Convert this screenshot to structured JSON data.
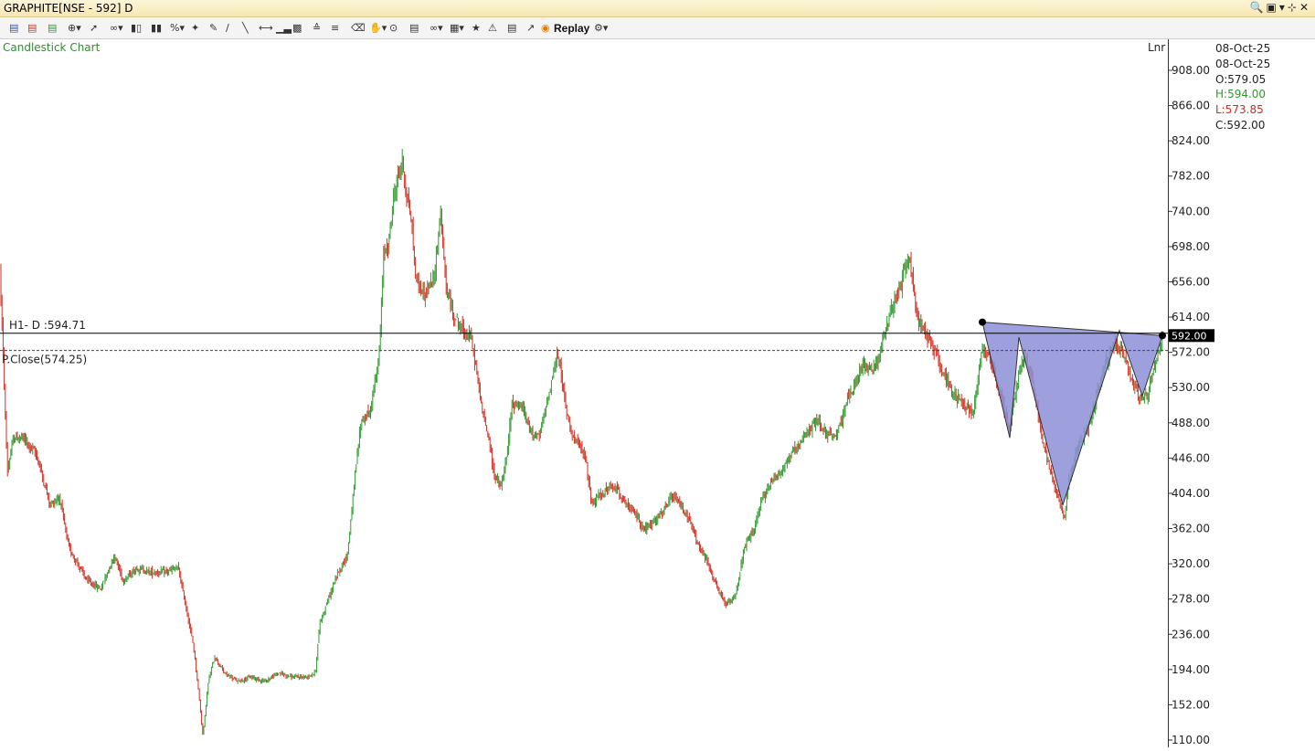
{
  "window": {
    "title": "GRAPHITE[NSE - 592] D"
  },
  "chart": {
    "type_label": "Candlestick Chart",
    "scale_mode": "Lnr",
    "hline_label": "H1- D :594.71",
    "hline_value": 594.71,
    "prev_close_label": "P.Close(574.25)",
    "prev_close_value": 574.25,
    "last_price_label": "592.00",
    "last_price": 592.0,
    "y_ticks": [
      "908.00",
      "866.00",
      "824.00",
      "782.00",
      "740.00",
      "698.00",
      "656.00",
      "614.00",
      "572.00",
      "530.00",
      "488.00",
      "446.00",
      "404.00",
      "362.00",
      "320.00",
      "278.00",
      "236.00",
      "194.00",
      "152.00",
      "110.00"
    ],
    "colors": {
      "up": "#2e9a2e",
      "down": "#d62a1e",
      "pattern_fill": "#8c8fd6",
      "title_green": "#2f8f2f"
    }
  },
  "toolbar": {
    "replay_label": "Replay"
  },
  "ohlc": {
    "date1": "08-Oct-25",
    "date2": "08-Oct-25",
    "open": "O:579.05",
    "high": "H:594.00",
    "low": "L:573.85",
    "close": "C:592.00"
  },
  "chart_data": {
    "type": "line",
    "title": "Candlestick Chart",
    "ylim": [
      110,
      908
    ],
    "y_ticks": [
      908,
      866,
      824,
      782,
      740,
      698,
      656,
      614,
      572,
      530,
      488,
      446,
      404,
      362,
      320,
      278,
      236,
      194,
      152,
      110
    ],
    "price_path": [
      [
        0,
        670
      ],
      [
        8,
        430
      ],
      [
        15,
        470
      ],
      [
        25,
        470
      ],
      [
        40,
        450
      ],
      [
        55,
        390
      ],
      [
        65,
        400
      ],
      [
        75,
        340
      ],
      [
        85,
        320
      ],
      [
        95,
        300
      ],
      [
        110,
        290
      ],
      [
        125,
        330
      ],
      [
        135,
        300
      ],
      [
        150,
        315
      ],
      [
        165,
        310
      ],
      [
        180,
        310
      ],
      [
        195,
        315
      ],
      [
        205,
        260
      ],
      [
        212,
        220
      ],
      [
        218,
        160
      ],
      [
        222,
        115
      ],
      [
        228,
        180
      ],
      [
        235,
        210
      ],
      [
        245,
        190
      ],
      [
        260,
        180
      ],
      [
        275,
        185
      ],
      [
        290,
        180
      ],
      [
        305,
        190
      ],
      [
        320,
        185
      ],
      [
        335,
        185
      ],
      [
        345,
        190
      ],
      [
        350,
        250
      ],
      [
        360,
        280
      ],
      [
        370,
        310
      ],
      [
        380,
        330
      ],
      [
        390,
        440
      ],
      [
        395,
        490
      ],
      [
        405,
        500
      ],
      [
        415,
        570
      ],
      [
        420,
        690
      ],
      [
        425,
        700
      ],
      [
        430,
        750
      ],
      [
        435,
        780
      ],
      [
        440,
        800
      ],
      [
        445,
        760
      ],
      [
        450,
        730
      ],
      [
        455,
        660
      ],
      [
        465,
        640
      ],
      [
        475,
        660
      ],
      [
        482,
        740
      ],
      [
        488,
        650
      ],
      [
        495,
        620
      ],
      [
        505,
        600
      ],
      [
        515,
        590
      ],
      [
        520,
        560
      ],
      [
        528,
        500
      ],
      [
        535,
        470
      ],
      [
        540,
        430
      ],
      [
        548,
        410
      ],
      [
        555,
        450
      ],
      [
        560,
        510
      ],
      [
        570,
        510
      ],
      [
        580,
        480
      ],
      [
        590,
        470
      ],
      [
        600,
        520
      ],
      [
        610,
        570
      ],
      [
        615,
        540
      ],
      [
        620,
        500
      ],
      [
        628,
        470
      ],
      [
        640,
        450
      ],
      [
        648,
        390
      ],
      [
        655,
        400
      ],
      [
        665,
        410
      ],
      [
        675,
        410
      ],
      [
        685,
        390
      ],
      [
        695,
        380
      ],
      [
        705,
        360
      ],
      [
        715,
        370
      ],
      [
        725,
        380
      ],
      [
        735,
        400
      ],
      [
        745,
        390
      ],
      [
        755,
        370
      ],
      [
        765,
        340
      ],
      [
        775,
        320
      ],
      [
        785,
        290
      ],
      [
        795,
        270
      ],
      [
        805,
        285
      ],
      [
        815,
        340
      ],
      [
        825,
        360
      ],
      [
        835,
        400
      ],
      [
        845,
        420
      ],
      [
        855,
        430
      ],
      [
        865,
        450
      ],
      [
        875,
        460
      ],
      [
        885,
        480
      ],
      [
        895,
        490
      ],
      [
        905,
        475
      ],
      [
        915,
        470
      ],
      [
        925,
        510
      ],
      [
        935,
        530
      ],
      [
        945,
        560
      ],
      [
        955,
        550
      ],
      [
        965,
        580
      ],
      [
        975,
        620
      ],
      [
        985,
        650
      ],
      [
        995,
        690
      ],
      [
        1000,
        640
      ],
      [
        1005,
        610
      ],
      [
        1015,
        590
      ],
      [
        1025,
        570
      ],
      [
        1035,
        540
      ],
      [
        1045,
        520
      ],
      [
        1055,
        510
      ],
      [
        1065,
        500
      ],
      [
        1075,
        580
      ],
      [
        1085,
        560
      ],
      [
        1095,
        520
      ],
      [
        1105,
        480
      ],
      [
        1110,
        520
      ],
      [
        1120,
        570
      ],
      [
        1130,
        540
      ],
      [
        1140,
        470
      ],
      [
        1150,
        430
      ],
      [
        1160,
        390
      ],
      [
        1165,
        380
      ],
      [
        1170,
        420
      ],
      [
        1180,
        460
      ],
      [
        1190,
        480
      ],
      [
        1200,
        520
      ],
      [
        1210,
        560
      ],
      [
        1220,
        580
      ],
      [
        1228,
        575
      ],
      [
        1238,
        540
      ],
      [
        1248,
        515
      ],
      [
        1256,
        520
      ],
      [
        1262,
        550
      ],
      [
        1268,
        575
      ],
      [
        1272,
        592
      ]
    ],
    "pattern_points": [
      [
        1075,
        608
      ],
      [
        1105,
        470
      ],
      [
        1115,
        590
      ],
      [
        1163,
        390
      ],
      [
        1225,
        598
      ],
      [
        1250,
        520
      ],
      [
        1272,
        592
      ]
    ],
    "hline": 594.71,
    "prev_close": 574.25,
    "last": 592.0,
    "grid": false
  }
}
